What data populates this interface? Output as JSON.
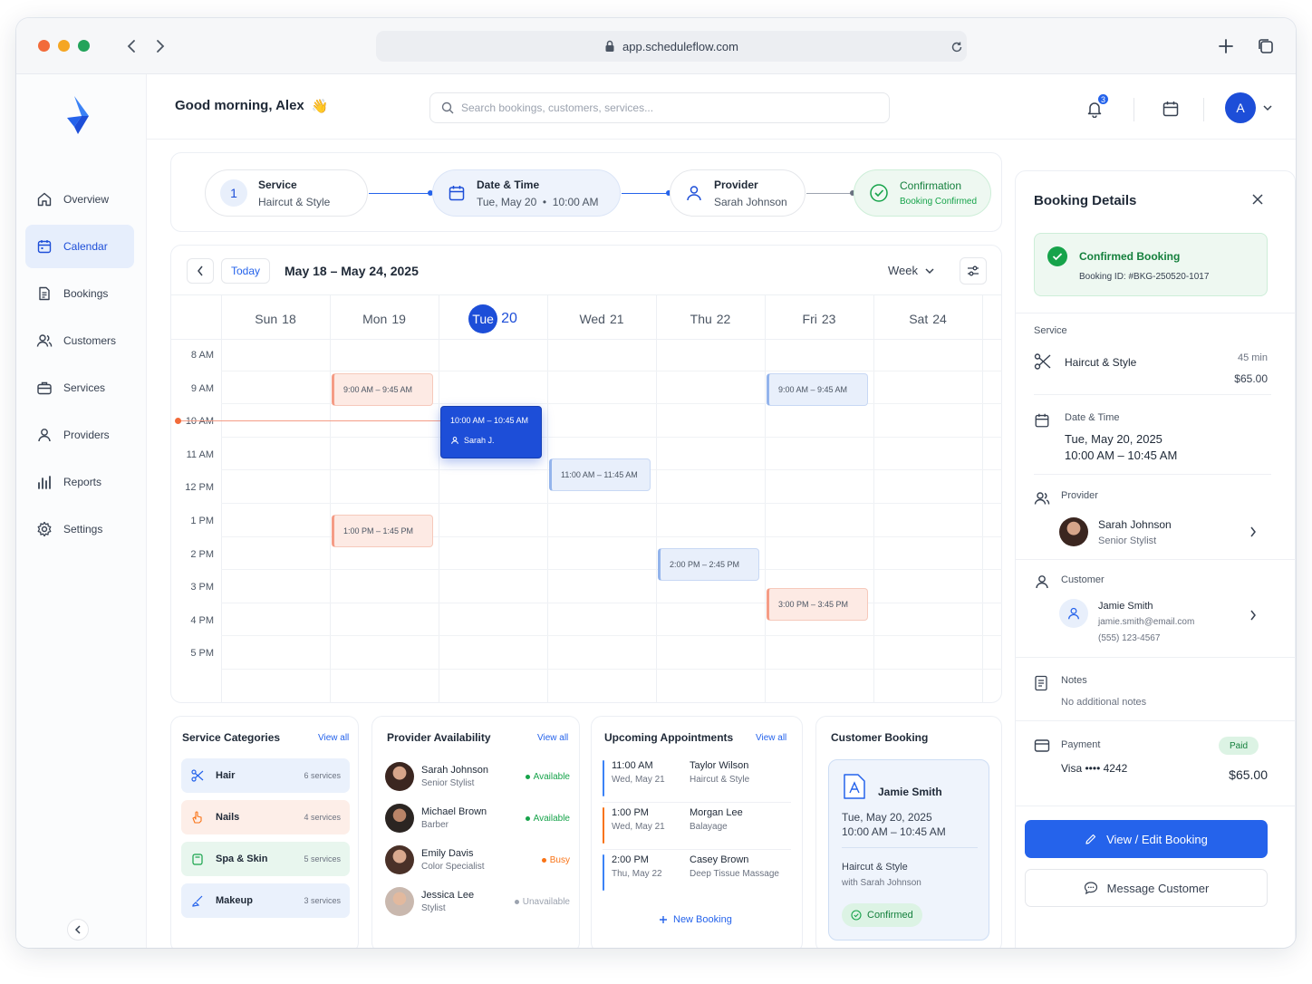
{
  "browser": {
    "url": "app.scheduleflow.com"
  },
  "sidebar": {
    "items": [
      {
        "label": "Overview"
      },
      {
        "label": "Calendar"
      },
      {
        "label": "Bookings"
      },
      {
        "label": "Customers"
      },
      {
        "label": "Services"
      },
      {
        "label": "Providers"
      },
      {
        "label": "Reports"
      },
      {
        "label": "Settings"
      }
    ],
    "active": "Calendar"
  },
  "header": {
    "greeting": "Good morning, Alex",
    "greeting_emoji": "👋",
    "search_placeholder": "Search bookings, customers, services...",
    "notification_count": "3",
    "avatar_initial": "A"
  },
  "stepper": {
    "steps": [
      {
        "number": "1",
        "title": "Service",
        "value": "Haircut & Style"
      },
      {
        "title": "Date & Time",
        "value": "Tue, May 20  •  10:00 AM"
      },
      {
        "title": "Provider",
        "value": "Sarah Johnson"
      },
      {
        "title": "Confirmation",
        "value": "Booking Confirmed"
      }
    ]
  },
  "calendar": {
    "today_label": "Today",
    "range": "May 18 – May 24, 2025",
    "view": "Week",
    "days": [
      {
        "name": "Sun",
        "num": "18"
      },
      {
        "name": "Mon",
        "num": "19"
      },
      {
        "name": "Tue",
        "num": "20",
        "today": true
      },
      {
        "name": "Wed",
        "num": "21"
      },
      {
        "name": "Thu",
        "num": "22"
      },
      {
        "name": "Fri",
        "num": "23"
      },
      {
        "name": "Sat",
        "num": "24"
      }
    ],
    "times": [
      "8 AM",
      "9 AM",
      "10 AM",
      "11 AM",
      "12 PM",
      "1 PM",
      "2 PM",
      "3 PM",
      "4 PM",
      "5 PM"
    ],
    "events": [
      {
        "label": "9:00 AM – 9:45 AM",
        "color": "orange",
        "day": 1
      },
      {
        "label": "9:00 AM – 9:45 AM",
        "color": "blue",
        "day": 5
      },
      {
        "label": "10:00 AM – 10:45 AM",
        "person": "Sarah J.",
        "color": "selected",
        "day": 2
      },
      {
        "label": "11:00 AM – 11:45 AM",
        "color": "blue",
        "day": 3
      },
      {
        "label": "1:00 PM – 1:45 PM",
        "color": "orange",
        "day": 1
      },
      {
        "label": "2:00 PM – 2:45 PM",
        "color": "blue",
        "day": 4
      },
      {
        "label": "3:00 PM – 3:45 PM",
        "color": "orange",
        "day": 5
      }
    ]
  },
  "service_categories": {
    "title": "Service Categories",
    "view_all": "View all",
    "items": [
      {
        "name": "Hair",
        "count": "6 services",
        "color": "#eaf1fc",
        "icon": "scissors-icon"
      },
      {
        "name": "Nails",
        "count": "4 services",
        "color": "#fdeee8",
        "icon": "hand-icon"
      },
      {
        "name": "Spa & Skin",
        "count": "5 services",
        "color": "#e8f6ee",
        "icon": "spa-icon"
      },
      {
        "name": "Makeup",
        "count": "3 services",
        "color": "#eaf1fc",
        "icon": "brush-icon"
      }
    ]
  },
  "provider_availability": {
    "title": "Provider Availability",
    "view_all": "View all",
    "items": [
      {
        "name": "Sarah Johnson",
        "role": "Senior Stylist",
        "status": "Available",
        "color": "#16a34a"
      },
      {
        "name": "Michael Brown",
        "role": "Barber",
        "status": "Available",
        "color": "#16a34a"
      },
      {
        "name": "Emily Davis",
        "role": "Color Specialist",
        "status": "Busy",
        "color": "#f97316"
      },
      {
        "name": "Jessica Lee",
        "role": "Stylist",
        "status": "Unavailable",
        "color": "#9ca3af"
      }
    ]
  },
  "upcoming": {
    "title": "Upcoming Appointments",
    "view_all": "View all",
    "items": [
      {
        "time": "11:00 AM",
        "date": "Wed, May 21",
        "name": "Taylor Wilson",
        "service": "Haircut & Style",
        "color": "#3b82f6"
      },
      {
        "time": "1:00 PM",
        "date": "Wed, May 21",
        "name": "Morgan Lee",
        "service": "Balayage",
        "color": "#f97316"
      },
      {
        "time": "2:00 PM",
        "date": "Thu, May 22",
        "name": "Casey Brown",
        "service": "Deep Tissue Massage",
        "color": "#3b82f6"
      }
    ],
    "new_booking": "New Booking"
  },
  "customer_booking": {
    "title": "Customer Booking",
    "name": "Jamie Smith",
    "date": "Tue, May 20, 2025",
    "time": "10:00 AM – 10:45 AM",
    "service": "Haircut & Style",
    "provider": "with Sarah Johnson",
    "status": "Confirmed"
  },
  "booking_details": {
    "title": "Booking Details",
    "status_title": "Confirmed Booking",
    "booking_id": "Booking ID: #BKG-250520-1017",
    "service_label": "Service",
    "service_name": "Haircut & Style",
    "duration": "45 min",
    "price": "$65.00",
    "datetime_label": "Date & Time",
    "date": "Tue, May 20, 2025",
    "time": "10:00 AM – 10:45 AM",
    "provider_label": "Provider",
    "provider_name": "Sarah Johnson",
    "provider_role": "Senior Stylist",
    "customer_label": "Customer",
    "customer_name": "Jamie Smith",
    "customer_email": "jamie.smith@email.com",
    "customer_phone": "(555) 123-4567",
    "notes_label": "Notes",
    "notes": "No additional notes",
    "payment_label": "Payment",
    "payment_status": "Paid",
    "payment_method": "Visa •••• 4242",
    "payment_amount": "$65.00",
    "primary_button": "View / Edit Booking",
    "secondary_button": "Message Customer"
  }
}
